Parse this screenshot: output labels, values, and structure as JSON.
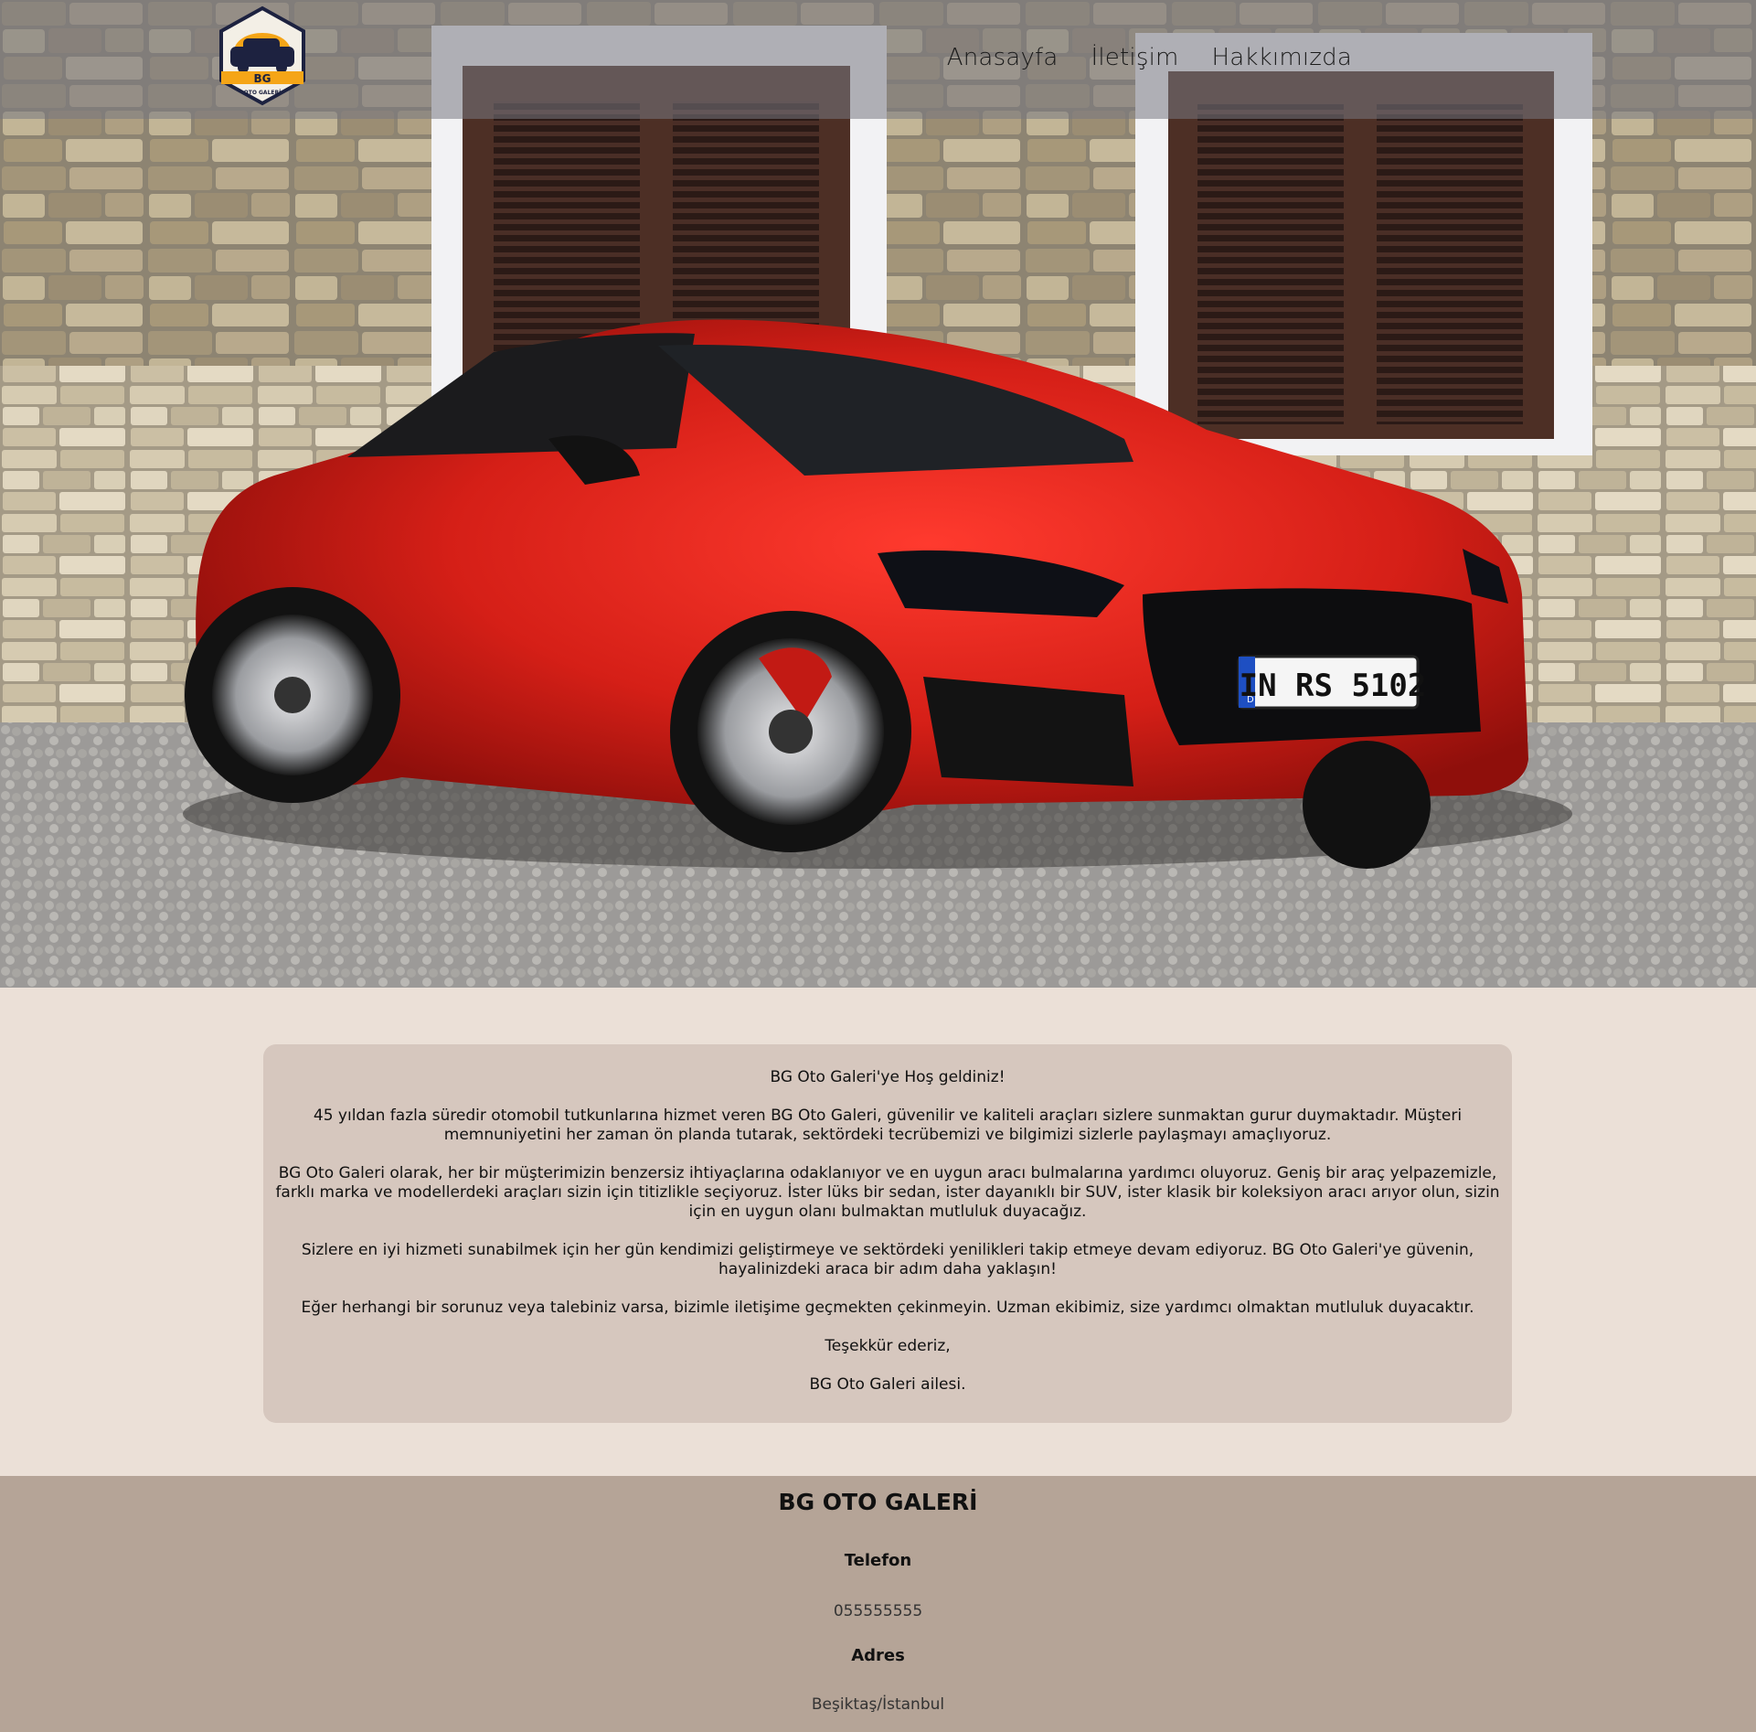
{
  "header": {
    "logo_text": "BG",
    "logo_subtext": "OTO GALERİ",
    "nav": [
      {
        "label": "Anasayfa"
      },
      {
        "label": "İletişim"
      },
      {
        "label": "Hakkımızda"
      }
    ]
  },
  "hero": {
    "plate_text": "IN RS 5102",
    "plate_country": "D"
  },
  "main": {
    "paragraphs": [
      "BG Oto Galeri'ye Hoş geldiniz!",
      "45 yıldan fazla süredir otomobil tutkunlarına hizmet veren BG Oto Galeri, güvenilir ve kaliteli araçları sizlere sunmaktan gurur duymaktadır. Müşteri memnuniyetini her zaman ön planda tutarak, sektördeki tecrübemizi ve bilgimizi sizlerle paylaşmayı amaçlıyoruz.",
      "BG Oto Galeri olarak, her bir müşterimizin benzersiz ihtiyaçlarına odaklanıyor ve en uygun aracı bulmalarına yardımcı oluyoruz. Geniş bir araç yelpazemizle, farklı marka ve modellerdeki araçları sizin için titizlikle seçiyoruz. İster lüks bir sedan, ister dayanıklı bir SUV, ister klasik bir koleksiyon aracı arıyor olun, sizin için en uygun olanı bulmaktan mutluluk duyacağız.",
      "Sizlere en iyi hizmeti sunabilmek için her gün kendimizi geliştirmeye ve sektördeki yenilikleri takip etmeye devam ediyoruz. BG Oto Galeri'ye güvenin, hayalinizdeki araca bir adım daha yaklaşın!",
      "Eğer herhangi bir sorunuz veya talebiniz varsa, bizimle iletişime geçmekten çekinmeyin. Uzman ekibimiz, size yardımcı olmaktan mutluluk duyacaktır.",
      "Teşekkür ederiz,",
      "BG Oto Galeri ailesi."
    ]
  },
  "footer": {
    "title": "BG OTO GALERİ",
    "phone_label": "Telefon",
    "phone_value": "055555555",
    "address_label": "Adres",
    "address_value": "Beşiktaş/İstanbul"
  },
  "colors": {
    "page_bg": "#ebe0d7",
    "card_bg": "#d6c7be",
    "footer_bg": "#b5a497",
    "car_red": "#d51f17"
  }
}
